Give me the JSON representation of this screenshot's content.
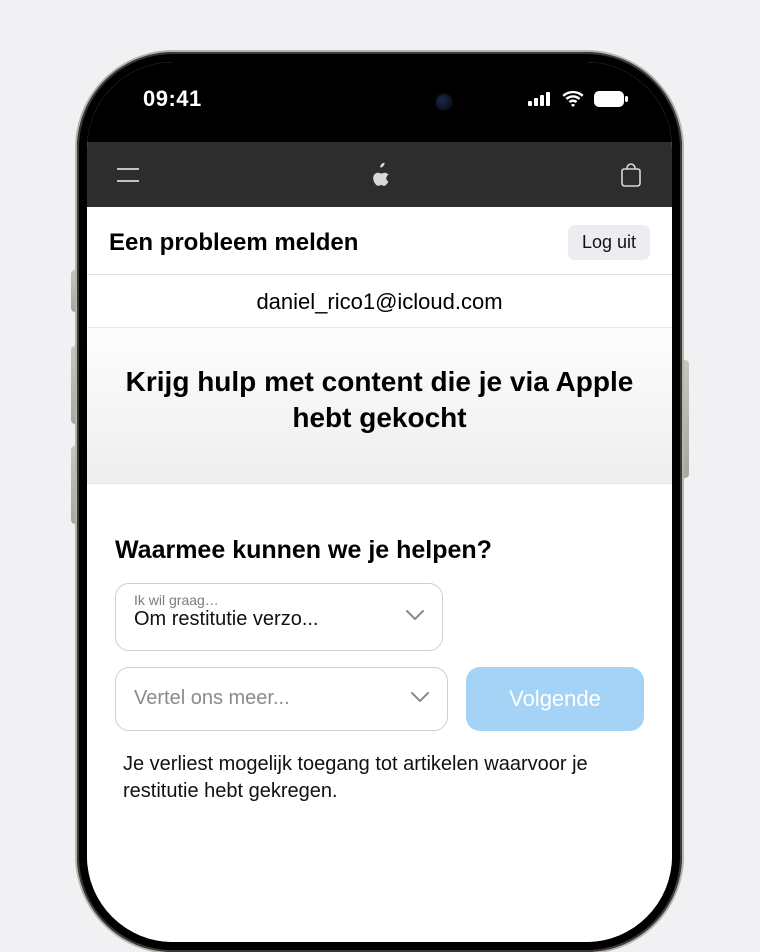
{
  "status": {
    "time": "09:41"
  },
  "header": {
    "title": "Een probleem melden",
    "logout": "Log uit"
  },
  "account": {
    "email": "daniel_rico1@icloud.com"
  },
  "hero": {
    "heading": "Krijg hulp met content die je via Apple hebt gekocht"
  },
  "form": {
    "prompt": "Waarmee kunnen we je helpen?",
    "select1": {
      "label": "Ik wil graag…",
      "value": "Om restitutie verzo..."
    },
    "select2": {
      "placeholder": "Vertel ons meer..."
    },
    "next": "Volgende",
    "note": "Je verliest mogelijk toegang tot artikelen waarvoor je restitutie hebt gekregen."
  }
}
